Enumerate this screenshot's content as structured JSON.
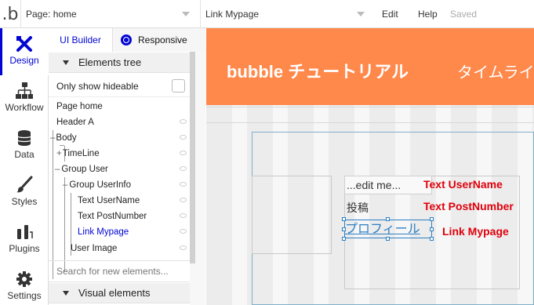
{
  "topbar": {
    "logo": ".b",
    "page_select": "Page: home",
    "element_select": "Link Mypage",
    "edit": "Edit",
    "help": "Help",
    "saved": "Saved"
  },
  "rail": {
    "items": [
      {
        "label": "Design",
        "icon": "design-icon"
      },
      {
        "label": "Workflow",
        "icon": "workflow-icon"
      },
      {
        "label": "Data",
        "icon": "data-icon"
      },
      {
        "label": "Styles",
        "icon": "brush-icon"
      },
      {
        "label": "Plugins",
        "icon": "plug-icon"
      },
      {
        "label": "Settings",
        "icon": "gear-icon"
      }
    ],
    "active_color": "#0205d3"
  },
  "panel": {
    "tab_ui": "UI Builder",
    "tab_responsive": "Responsive",
    "elements_tree": "Elements tree",
    "only_hideable": "Only show hideable",
    "tree": [
      "Page home",
      "Header A",
      "Body",
      "TimeLine",
      "Group User",
      "Group UserInfo",
      "Text UserName",
      "Text PostNumber",
      "Link Mypage",
      "User Image"
    ],
    "search_placeholder": "Search for new elements...",
    "visual_elements": "Visual elements"
  },
  "canvas": {
    "header_title": "bubble チュートリアル",
    "header_tab": "タイムライ",
    "text_username_value": "...edit me...",
    "text_postnumber_value": "投稿",
    "link_value": "プロフィール",
    "label_username": "Text UserName",
    "label_postnumber": "Text PostNumber",
    "label_link": "Link Mypage",
    "header_color": "#ff884b",
    "annotation_color": "#e0000b"
  }
}
